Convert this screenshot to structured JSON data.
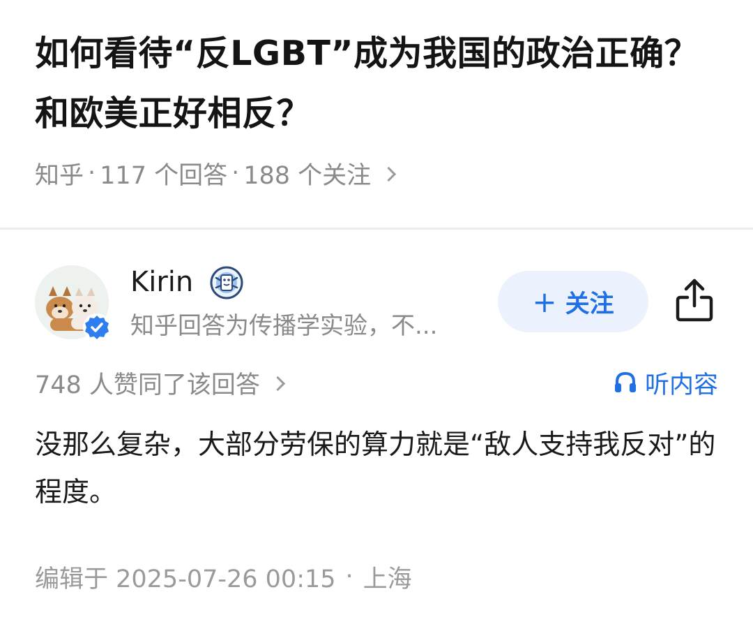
{
  "question": {
    "title": "如何看待“反LGBT”成为我国的政治正确？和欧美正好相反？",
    "source": "知乎",
    "separator": "·",
    "answers_count": "117 个回答",
    "followers_count": "188 个关注"
  },
  "author": {
    "name": "Kirin",
    "bio": "知乎回答为传播学实验，不...",
    "avatar_icon": "shiba-dogs-avatar",
    "verified_icon": "verified-check-icon",
    "medal_icon": "creator-medal-icon"
  },
  "actions": {
    "follow_label": "关注",
    "follow_plus": "+",
    "share_icon": "share-icon"
  },
  "answer": {
    "votes_text": "748 人赞同了该回答",
    "listen_label": "听内容",
    "body": "没那么复杂，大部分劳保的算力就是“敌人支持我反对”的程度。",
    "edited": "编辑于 2025-07-26 00:15",
    "footer_separator": "·",
    "location": "上海"
  },
  "colors": {
    "accent": "#1f6fe5",
    "follow_bg": "#ebf2fd",
    "muted_text": "#8a8a8a",
    "divider": "#ececec"
  }
}
